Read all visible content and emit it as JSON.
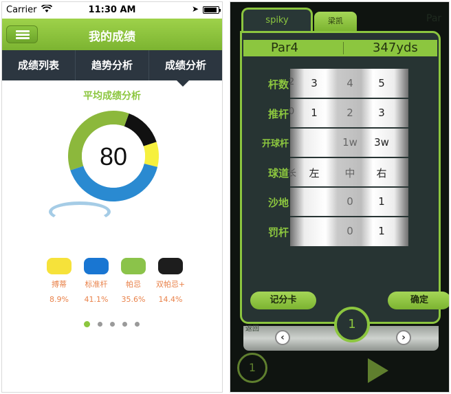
{
  "left": {
    "status": {
      "carrier": "Carrier",
      "time": "11:30 AM"
    },
    "header": {
      "title": "我的成绩"
    },
    "tabs": [
      {
        "label": "成绩列表"
      },
      {
        "label": "趋势分析"
      },
      {
        "label": "成绩分析"
      }
    ],
    "section_title": "平均成绩分析",
    "donut": {
      "center_value": "80",
      "segments": [
        {
          "name": "搏蒂",
          "percent": 8.9,
          "color": "#f6f03e"
        },
        {
          "name": "标准杆",
          "percent": 41.1,
          "color": "#2a8ad1"
        },
        {
          "name": "帕忌",
          "percent": 35.6,
          "color": "#8cb83c"
        },
        {
          "name": "双帕忌+",
          "percent": 14.4,
          "color": "#111111"
        }
      ]
    },
    "legend": [
      {
        "label": "搏蒂",
        "value": "8.9%",
        "color": "#f6e23a"
      },
      {
        "label": "标准杆",
        "value": "41.1%",
        "color": "#1976d2"
      },
      {
        "label": "帕忌",
        "value": "35.6%",
        "color": "#8bc34a"
      },
      {
        "label": "双帕忌+",
        "value": "14.4%",
        "color": "#1d1d1d"
      }
    ],
    "pager": {
      "count": 5,
      "active": 0
    }
  },
  "right": {
    "tabs": [
      {
        "label": "spiky"
      },
      {
        "label": "梁凯"
      }
    ],
    "par_label": "Par4",
    "distance": "347yds",
    "rows": [
      {
        "label": "杆数",
        "cells": [
          "3",
          "4",
          "5"
        ],
        "left_edge": "2"
      },
      {
        "label": "推杆",
        "cells": [
          "1",
          "2",
          "3"
        ],
        "left_edge": "0"
      },
      {
        "label": "开球杆",
        "cells": [
          "",
          "1w",
          "3w"
        ],
        "left_edge": ""
      },
      {
        "label": "球道",
        "cells": [
          "左",
          "中",
          "右"
        ],
        "left_edge": "长"
      },
      {
        "label": "沙地",
        "cells": [
          "",
          "0",
          "1"
        ],
        "left_edge": ""
      },
      {
        "label": "罚杆",
        "cells": [
          "",
          "0",
          "1"
        ],
        "left_edge": ""
      }
    ],
    "buttons": {
      "scorecard": "记分卡",
      "confirm": "确定"
    },
    "hole": "1",
    "nav": {
      "prev": "‹",
      "next": "›"
    },
    "bottom": {
      "back_label": "返回",
      "hole": "1"
    }
  }
}
